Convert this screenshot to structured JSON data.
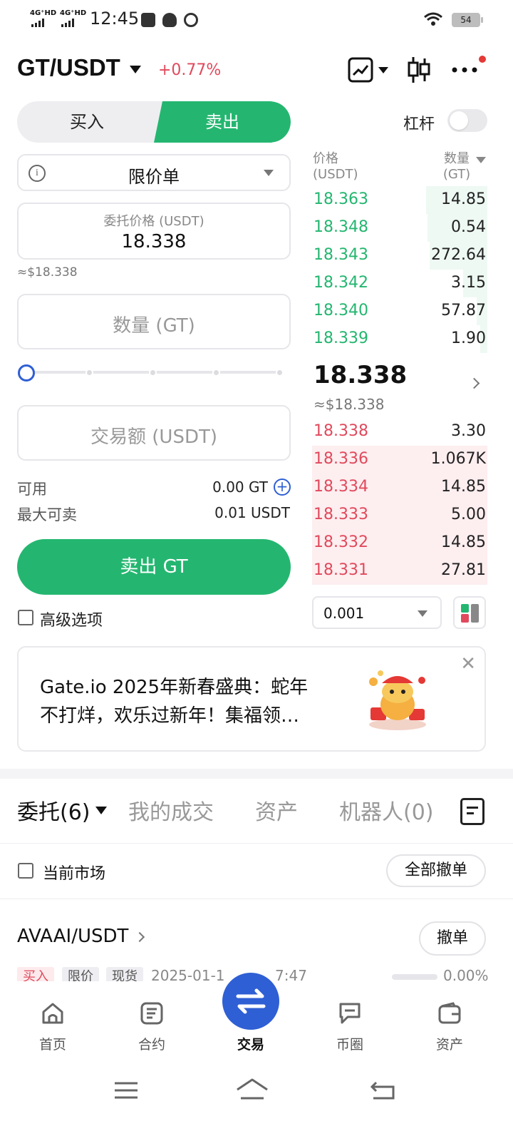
{
  "status_bar": {
    "sig1": "4G⁺HD",
    "sig2": "4G⁺HD",
    "time": "12:45",
    "battery": "54"
  },
  "header": {
    "pair": "GT/USDT",
    "change": "+0.77%"
  },
  "trade_tabs": {
    "buy": "买入",
    "sell": "卖出"
  },
  "leverage": {
    "label": "杠杆",
    "enabled": false
  },
  "form": {
    "order_type": "限价单",
    "price_label": "委托价格 (USDT)",
    "price_value": "18.338",
    "price_usd": "≈$18.338",
    "qty_placeholder": "数量 (GT)",
    "slider_percent": 0,
    "amount_placeholder": "交易额 (USDT)",
    "available_label": "可用",
    "available_value": "0.00 GT",
    "max_sell_label": "最大可卖",
    "max_sell_value": "0.01 USDT",
    "submit_label": "卖出 GT",
    "advanced_label": "高级选项"
  },
  "orderbook": {
    "price_header": "价格",
    "price_unit": "(USDT)",
    "qty_header": "数量",
    "qty_unit": "(GT)",
    "asks": [
      {
        "price": "18.363",
        "qty": "14.85",
        "depth": 0.35
      },
      {
        "price": "18.348",
        "qty": "0.54",
        "depth": 0.34
      },
      {
        "price": "18.343",
        "qty": "272.64",
        "depth": 0.33
      },
      {
        "price": "18.342",
        "qty": "3.15",
        "depth": 0.14
      },
      {
        "price": "18.340",
        "qty": "57.87",
        "depth": 0.06
      },
      {
        "price": "18.339",
        "qty": "1.90",
        "depth": 0.04
      }
    ],
    "last_price": "18.338",
    "last_price_usd": "≈$18.338",
    "bids": [
      {
        "price": "18.338",
        "qty": "3.30",
        "depth": 0.0
      },
      {
        "price": "18.336",
        "qty": "1.067K",
        "depth": 1.0
      },
      {
        "price": "18.334",
        "qty": "14.85",
        "depth": 1.0
      },
      {
        "price": "18.333",
        "qty": "5.00",
        "depth": 1.0
      },
      {
        "price": "18.332",
        "qty": "14.85",
        "depth": 1.0
      },
      {
        "price": "18.331",
        "qty": "27.81",
        "depth": 1.0
      }
    ],
    "precision": "0.001"
  },
  "banner": {
    "text": "Gate.io 2025年新春盛典：蛇年\n不打烊，欢乐过新年！集福领…"
  },
  "bottom_tabs": {
    "orders": "委托(6)",
    "trades": "我的成交",
    "assets": "资产",
    "bots": "机器人(0)"
  },
  "filter": {
    "current_market": "当前市场",
    "cancel_all": "全部撤单"
  },
  "order": {
    "pair": "AVAAI/USDT",
    "cancel": "撤单",
    "side": "买入",
    "type": "限价",
    "market": "现货",
    "time": "2025-01-1",
    "time_tail": "7:47",
    "progress": "0.00%"
  },
  "nav": {
    "home": "首页",
    "futures": "合约",
    "trade": "交易",
    "community": "币圈",
    "assets": "资产"
  },
  "colors": {
    "green": "#24b670",
    "red": "#e04a5c",
    "blue": "#2f5fd4"
  }
}
